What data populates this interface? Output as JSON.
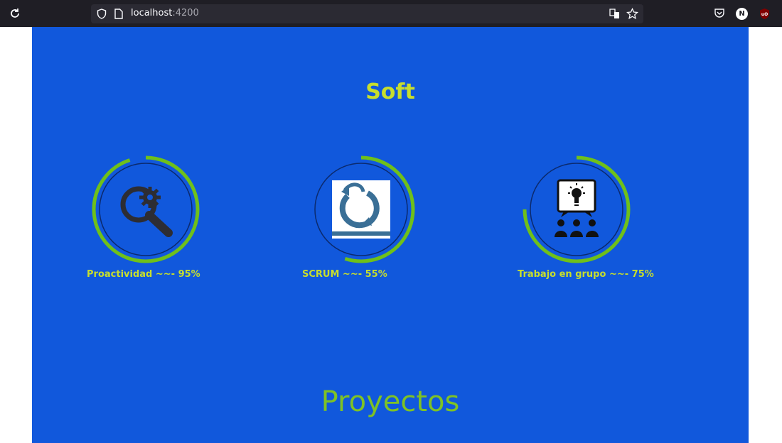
{
  "browser": {
    "url_host": "localhost",
    "url_port": ":4200",
    "profile_initial": "N"
  },
  "sections": {
    "soft_title": "Soft",
    "projects_title": "Proyectos"
  },
  "skills": [
    {
      "label": "Proactividad ~~- 95%",
      "percent": 95,
      "icon": "magnifier-gear-icon"
    },
    {
      "label": "SCRUM ~~- 55%",
      "percent": 55,
      "icon": "scrum-cycle-icon"
    },
    {
      "label": "Trabajo en grupo ~~- 75%",
      "percent": 75,
      "icon": "team-idea-icon"
    }
  ],
  "colors": {
    "page_background": "#1158dc",
    "title_yellow": "#c7de2d",
    "projects_green": "#7ec225",
    "ring_green": "#6fc01a",
    "browser_bar": "#1f1e25"
  }
}
